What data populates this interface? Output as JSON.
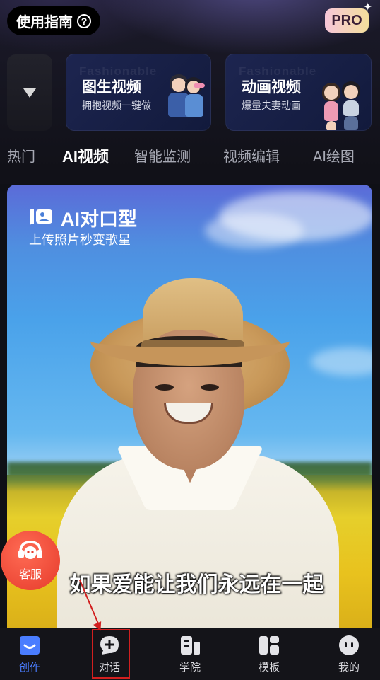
{
  "header": {
    "guide_label": "使用指南",
    "help_glyph": "?",
    "pro_badge": "PRO",
    "sparkle_glyph": "✦"
  },
  "feature_cards": [
    {
      "title": "图生视频",
      "subtitle": "拥抱视频一键做",
      "ghost_text": "Fashionable"
    },
    {
      "title": "动画视频",
      "subtitle": "爆量夫妻动画",
      "ghost_text": "Fashionable"
    }
  ],
  "tabs": [
    {
      "label": "热门"
    },
    {
      "label": "AI视频",
      "active": true
    },
    {
      "label": "智能监测"
    },
    {
      "label": "视频编辑"
    },
    {
      "label": "AI绘图"
    }
  ],
  "hero": {
    "title": "AI对口型",
    "subtitle": "上传照片秒变歌星",
    "lyric": "如果爱能让我们永远在一起"
  },
  "customer_service": {
    "label": "客服"
  },
  "tabbar": [
    {
      "label": "创作",
      "icon": "create-icon",
      "active": true
    },
    {
      "label": "对话",
      "icon": "chat-plus-icon"
    },
    {
      "label": "学院",
      "icon": "academy-icon"
    },
    {
      "label": "模板",
      "icon": "template-icon"
    },
    {
      "label": "我的",
      "icon": "profile-icon"
    }
  ],
  "colors": {
    "accent": "#4a7dff",
    "annotation_red": "#d21f1f",
    "cs_red": "#e63b2b"
  }
}
